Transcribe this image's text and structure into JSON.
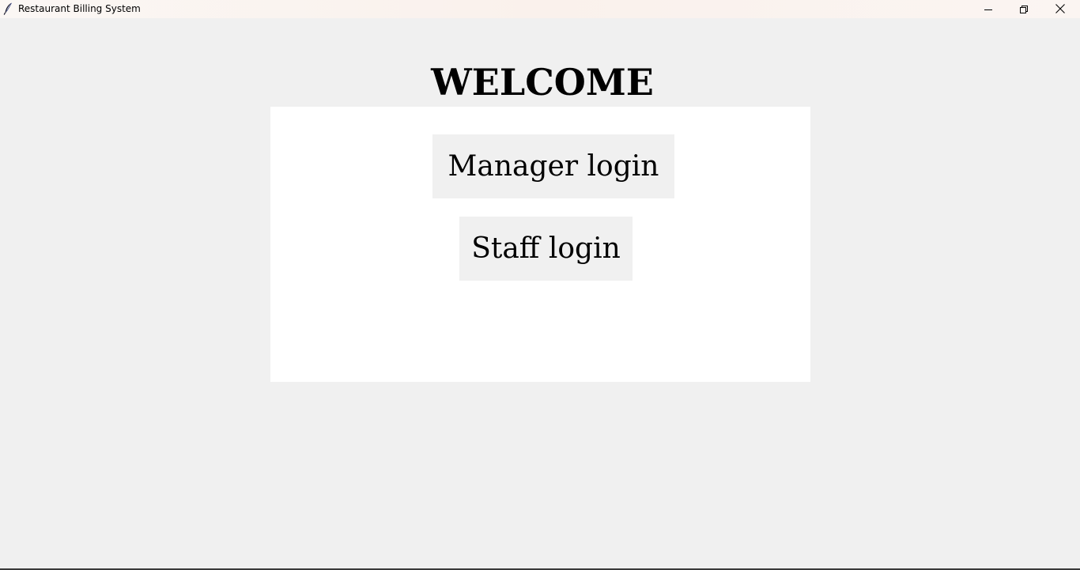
{
  "window": {
    "title": "Restaurant Billing System",
    "icons": {
      "app": "feather-icon",
      "minimize": "minimize-icon",
      "maximize": "restore-icon",
      "close": "close-icon"
    }
  },
  "main": {
    "heading": "WELCOME",
    "buttons": {
      "manager": "Manager login",
      "staff": "Staff login"
    }
  },
  "colors": {
    "background": "#f0f0f0",
    "panel": "#ffffff",
    "button": "#f0f0f0",
    "text": "#000000"
  }
}
